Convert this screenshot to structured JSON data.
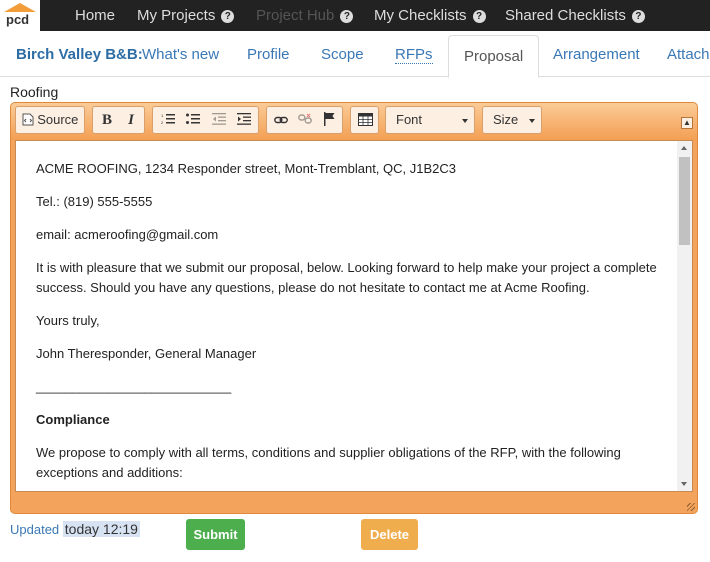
{
  "app": {
    "logo_text": "pcd"
  },
  "topnav": [
    {
      "label": "Home",
      "help": false,
      "muted": false
    },
    {
      "label": "My Projects",
      "help": true,
      "muted": false
    },
    {
      "label": "Project Hub",
      "help": true,
      "muted": true
    },
    {
      "label": "My Checklists",
      "help": true,
      "muted": false
    },
    {
      "label": "Shared Checklists",
      "help": true,
      "muted": false
    }
  ],
  "tabs": {
    "project_name": "Birch Valley B&B:",
    "items": [
      "What's new",
      "Profile",
      "Scope",
      "RFPs",
      "Proposal",
      "Arrangement",
      "Attachi"
    ],
    "active": "Proposal"
  },
  "section_label": "Roofing",
  "toolbar": {
    "source_label": "Source",
    "bold_label": "B",
    "italic_label": "I",
    "font_label": "Font",
    "size_label": "Size"
  },
  "editor": {
    "paragraphs": [
      {
        "text": "ACME ROOFING, 1234 Responder street, Mont-Tremblant, QC, J1B2C3",
        "bold": false
      },
      {
        "text": "Tel.: (819) 555-5555",
        "bold": false
      },
      {
        "text": "email: acmeroofing@gmail.com",
        "bold": false
      },
      {
        "text": "It is with pleasure that we submit our proposal, below. Looking forward to help make your project a complete success. Should you have any questions, please do not hesitate to contact me at Acme Roofing.",
        "bold": false
      },
      {
        "text": "Yours truly,",
        "bold": false
      },
      {
        "text": "John Theresponder, General Manager",
        "bold": false
      },
      {
        "text": "___________________________",
        "bold": false
      },
      {
        "text": "Compliance",
        "bold": true
      },
      {
        "text": "We propose to comply with all terms, conditions and supplier obligations of the RFP, with the following exceptions and additions:",
        "bold": false
      }
    ]
  },
  "footer": {
    "updated_label": "Updated",
    "timestamp": "today 12:19",
    "submit_label": "Submit",
    "delete_label": "Delete"
  },
  "colors": {
    "accent": "#f39c3a",
    "link": "#3a78b5",
    "submit": "#4cae4c",
    "delete": "#f0ad4e",
    "navbar": "#222222"
  }
}
